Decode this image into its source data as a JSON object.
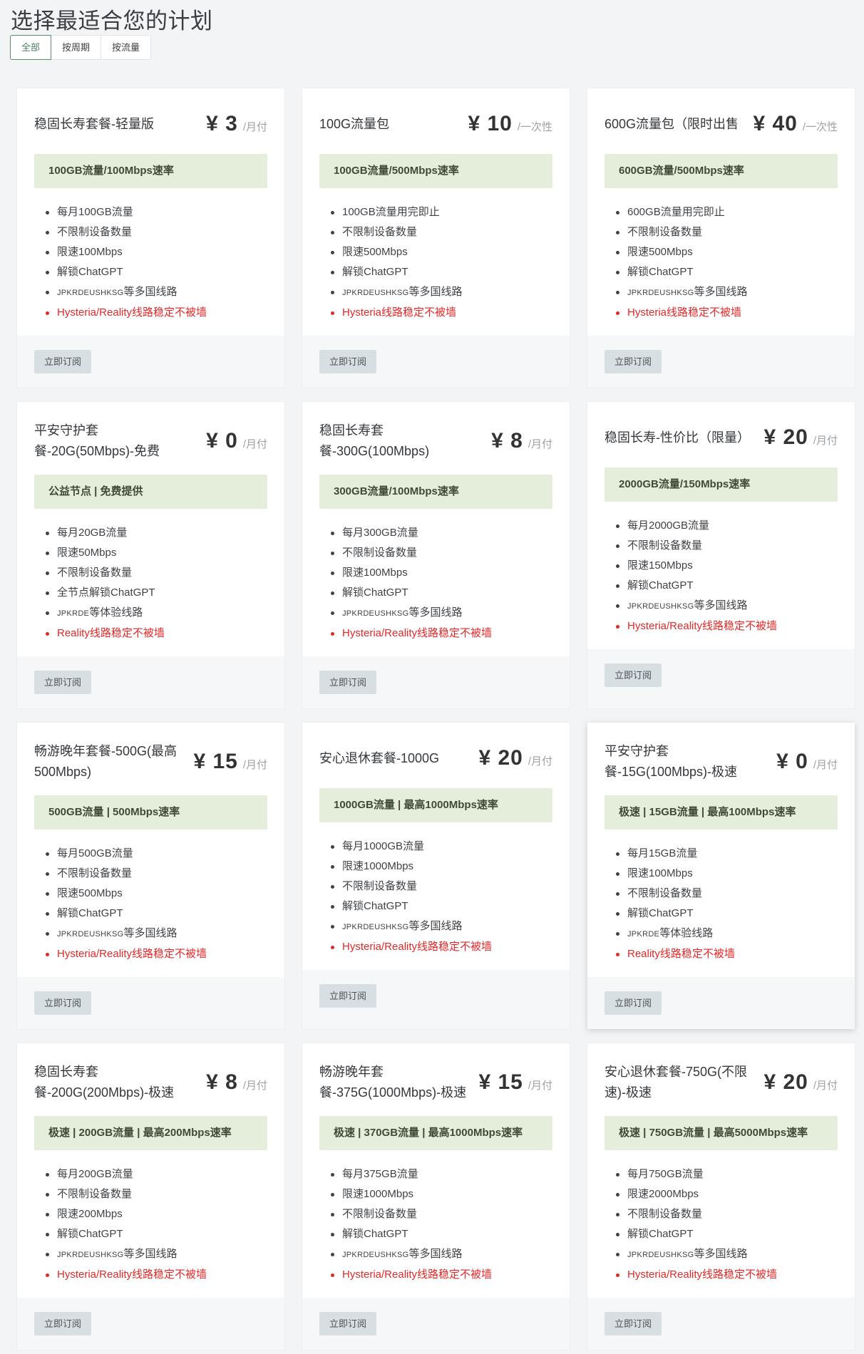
{
  "page": {
    "title": "选择最适合您的计划"
  },
  "filters": [
    {
      "label": "全部",
      "active": true
    },
    {
      "label": "按周期",
      "active": false
    },
    {
      "label": "按流量",
      "active": false
    }
  ],
  "subscribe_label": "立即订阅",
  "plans": [
    {
      "name": "稳固长寿套餐-轻量版",
      "price": "¥ 3",
      "unit": "/月付",
      "highlight": "100GB流量/100Mbps速率",
      "features": [
        "每月100GB流量",
        "不限制设备数量",
        "限速100Mbps",
        "解锁ChatGPT"
      ],
      "regions_code": "JPKRDEUSHKSG",
      "regions_suffix": "等多国线路",
      "warning": "Hysteria/Reality线路稳定不被墙"
    },
    {
      "name": "100G流量包",
      "price": "¥ 10",
      "unit": "/一次性",
      "highlight": "100GB流量/500Mbps速率",
      "features": [
        "100GB流量用完即止",
        "不限制设备数量",
        "限速500Mbps",
        "解锁ChatGPT"
      ],
      "regions_code": "JPKRDEUSHKSG",
      "regions_suffix": "等多国线路",
      "warning": "Hysteria线路稳定不被墙"
    },
    {
      "name": "600G流量包（限时出售",
      "price": "¥ 40",
      "unit": "/一次性",
      "highlight": "600GB流量/500Mbps速率",
      "features": [
        "600GB流量用完即止",
        "不限制设备数量",
        "限速500Mbps",
        "解锁ChatGPT"
      ],
      "regions_code": "JPKRDEUSHKSG",
      "regions_suffix": "等多国线路",
      "warning": "Hysteria线路稳定不被墙"
    },
    {
      "name": "平安守护套餐-20G(50Mbps)-免费",
      "price": "¥ 0",
      "unit": "/月付",
      "highlight": "公益节点 | 免费提供",
      "features": [
        "每月20GB流量",
        "限速50Mbps",
        "不限制设备数量",
        "全节点解锁ChatGPT"
      ],
      "regions_code": "JPKRDE",
      "regions_suffix": "等体验线路",
      "warning": "Reality线路稳定不被墙"
    },
    {
      "name": "稳固长寿套餐-300G(100Mbps)",
      "price": "¥ 8",
      "unit": "/月付",
      "highlight": "300GB流量/100Mbps速率",
      "features": [
        "每月300GB流量",
        "不限制设备数量",
        "限速100Mbps",
        "解锁ChatGPT"
      ],
      "regions_code": "JPKRDEUSHKSG",
      "regions_suffix": "等多国线路",
      "warning": "Hysteria/Reality线路稳定不被墙"
    },
    {
      "name": "稳固长寿-性价比（限量）",
      "price": "¥ 20",
      "unit": "/月付",
      "highlight": "2000GB流量/150Mbps速率",
      "features": [
        "每月2000GB流量",
        "不限制设备数量",
        "限速150Mbps",
        "解锁ChatGPT"
      ],
      "regions_code": "JPKRDEUSHKSG",
      "regions_suffix": "等多国线路",
      "warning": "Hysteria/Reality线路稳定不被墙"
    },
    {
      "name": "畅游晚年套餐-500G(最高500Mbps)",
      "price": "¥ 15",
      "unit": "/月付",
      "highlight": "500GB流量 | 500Mbps速率",
      "features": [
        "每月500GB流量",
        "不限制设备数量",
        "限速500Mbps",
        "解锁ChatGPT"
      ],
      "regions_code": "JPKRDEUSHKSG",
      "regions_suffix": "等多国线路",
      "warning": "Hysteria/Reality线路稳定不被墙"
    },
    {
      "name": "安心退休套餐-1000G",
      "price": "¥ 20",
      "unit": "/月付",
      "highlight": "1000GB流量 | 最高1000Mbps速率",
      "features": [
        "每月1000GB流量",
        "限速1000Mbps",
        "不限制设备数量",
        "解锁ChatGPT"
      ],
      "regions_code": "JPKRDEUSHKSG",
      "regions_suffix": "等多国线路",
      "warning": "Hysteria/Reality线路稳定不被墙"
    },
    {
      "name": "平安守护套餐-15G(100Mbps)-极速",
      "price": "¥ 0",
      "unit": "/月付",
      "highlight": "极速 | 15GB流量 | 最高100Mbps速率",
      "features": [
        "每月15GB流量",
        "限速100Mbps",
        "不限制设备数量",
        "解锁ChatGPT"
      ],
      "regions_code": "JPKRDE",
      "regions_suffix": "等体验线路",
      "warning": "Reality线路稳定不被墙"
    },
    {
      "name": "稳固长寿套餐-200G(200Mbps)-极速",
      "price": "¥ 8",
      "unit": "/月付",
      "highlight": "极速 | 200GB流量 | 最高200Mbps速率",
      "features": [
        "每月200GB流量",
        "不限制设备数量",
        "限速200Mbps",
        "解锁ChatGPT"
      ],
      "regions_code": "JPKRDEUSHKSG",
      "regions_suffix": "等多国线路",
      "warning": "Hysteria/Reality线路稳定不被墙"
    },
    {
      "name": "畅游晚年套餐-375G(1000Mbps)-极速",
      "price": "¥ 15",
      "unit": "/月付",
      "highlight": "极速 | 370GB流量 | 最高1000Mbps速率",
      "features": [
        "每月375GB流量",
        "限速1000Mbps",
        "不限制设备数量",
        "解锁ChatGPT"
      ],
      "regions_code": "JPKRDEUSHKSG",
      "regions_suffix": "等多国线路",
      "warning": "Hysteria/Reality线路稳定不被墙"
    },
    {
      "name": "安心退休套餐-750G(不限速)-极速",
      "price": "¥ 20",
      "unit": "/月付",
      "highlight": "极速 | 750GB流量 | 最高5000Mbps速率",
      "features": [
        "每月750GB流量",
        "限速2000Mbps",
        "不限制设备数量",
        "解锁ChatGPT"
      ],
      "regions_code": "JPKRDEUSHKSG",
      "regions_suffix": "等多国线路",
      "warning": "Hysteria/Reality线路稳定不被墙"
    }
  ]
}
